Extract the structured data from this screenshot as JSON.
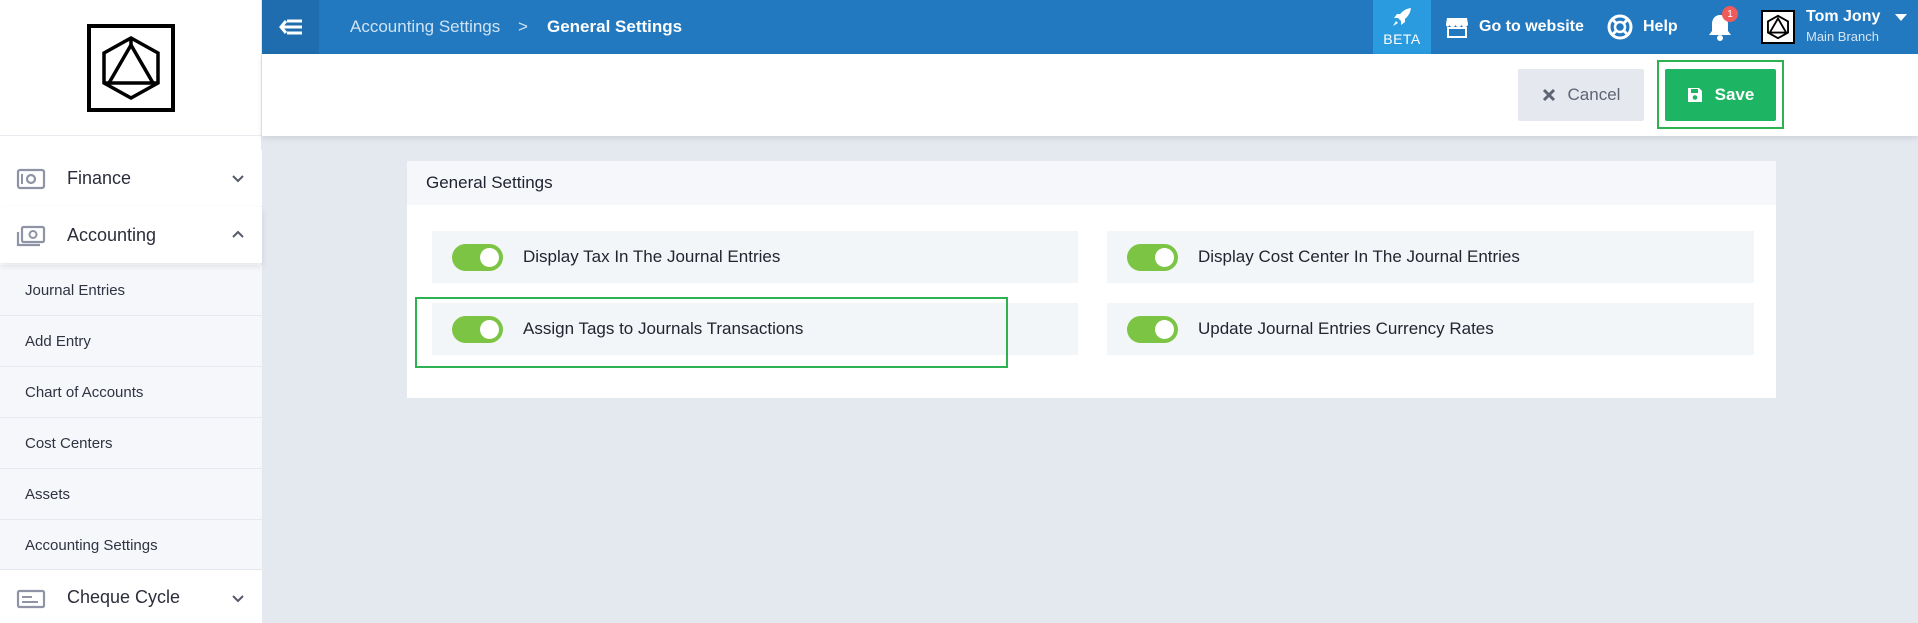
{
  "sidebar": {
    "sections": [
      {
        "label": "Finance",
        "icon": "safe-icon",
        "expanded": false
      },
      {
        "label": "Accounting",
        "icon": "money-icon",
        "expanded": true
      },
      {
        "label": "Cheque Cycle",
        "icon": "cheque-icon",
        "expanded": false
      }
    ],
    "sub_items": [
      "Journal Entries",
      "Add Entry",
      "Chart of Accounts",
      "Cost Centers",
      "Assets",
      "Accounting Settings"
    ]
  },
  "topbar": {
    "breadcrumb": [
      "Accounting Settings",
      "General Settings"
    ],
    "breadcrumb_separator": ">",
    "beta_label": "BETA",
    "go_to_website": "Go to website",
    "help": "Help",
    "notifications_count": "1",
    "user_name": "Tom Jony",
    "user_branch": "Main Branch",
    "accent_color": "#2279bf"
  },
  "actions": {
    "cancel_label": "Cancel",
    "save_label": "Save",
    "save_color": "#1db464"
  },
  "card": {
    "title": "General Settings",
    "settings": [
      {
        "label": "Display Tax In The Journal Entries",
        "enabled": true
      },
      {
        "label": "Display Cost Center In The Journal Entries",
        "enabled": true
      },
      {
        "label": "Assign Tags to Journals Transactions",
        "enabled": true,
        "highlighted": true
      },
      {
        "label": "Update Journal Entries Currency Rates",
        "enabled": true
      }
    ],
    "toggle_on_color": "#7cc443",
    "highlight_color": "#2eb150"
  }
}
